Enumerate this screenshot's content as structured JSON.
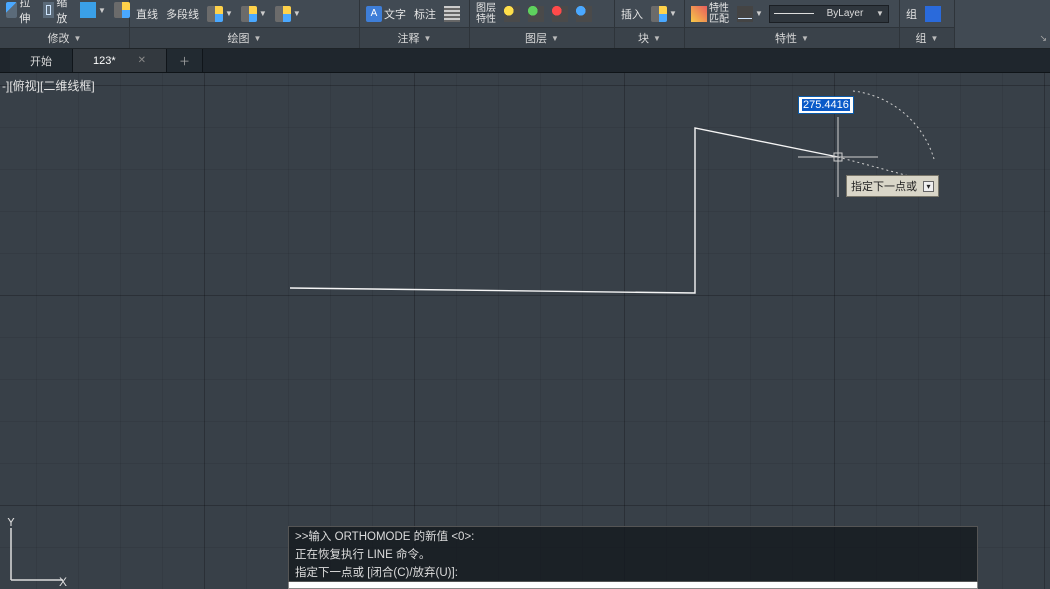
{
  "ribbon": {
    "modify": {
      "stretch": "拉伸",
      "scale": "缩放",
      "title": "修改"
    },
    "draw": {
      "btn1": "直线",
      "btn2": "多段线",
      "title": "绘图"
    },
    "anno": {
      "btn1": "文字",
      "btn2": "标注",
      "title": "注释"
    },
    "layer": {
      "btn1": "图层",
      "btn2": "特性",
      "title": "图层"
    },
    "block": {
      "btn1": "插入",
      "title": "块"
    },
    "props": {
      "btn1": "特性",
      "btn2": "匹配",
      "bylayer": "ByLayer",
      "title": "特性"
    },
    "group": {
      "btn1": "组",
      "title": "组"
    }
  },
  "tabs": {
    "start": "开始",
    "doc1": "123*"
  },
  "viewport": {
    "label": "-][俯视][二维线框]"
  },
  "dynamic_input": {
    "value": "275.4416"
  },
  "tooltip": {
    "text": "指定下一点或"
  },
  "ucs": {
    "y": "Y",
    "x": "X"
  },
  "command": {
    "line1": ">>输入 ORTHOMODE 的新值 <0>:",
    "line2": "正在恢复执行 LINE 命令。",
    "line3": "指定下一点或 [闭合(C)/放弃(U)]:"
  }
}
